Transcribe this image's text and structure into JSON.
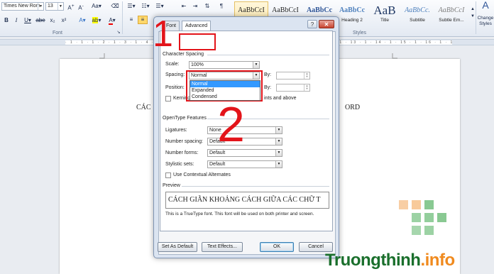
{
  "ribbon": {
    "font_name": "Times New Rom",
    "font_size": "13",
    "font_group_label": "Font",
    "styles_group_label": "Styles",
    "change_styles": "Change Styles",
    "styles": [
      {
        "sample": "AaBbCcI",
        "name": "",
        "active": true
      },
      {
        "sample": "AaBbCcI",
        "name": ""
      },
      {
        "sample": "AaBbCc",
        "name": ""
      },
      {
        "sample": "AaBbCc",
        "name": "Heading 2"
      },
      {
        "sample": "AaB",
        "name": "Title"
      },
      {
        "sample": "AaBbCc.",
        "name": "Subtitle"
      },
      {
        "sample": "AaBbCcI",
        "name": "Subtle Em..."
      }
    ]
  },
  "document": {
    "text_left": "CÁC",
    "text_right": "ORD"
  },
  "dialog": {
    "tabs": [
      "Font",
      "Advanced"
    ],
    "section_character_spacing": "Character Spacing",
    "scale_label": "Scale:",
    "scale_value": "100%",
    "spacing_label": "Spacing:",
    "spacing_value": "Normal",
    "by_label_1": "By:",
    "position_label": "Position:",
    "by_label_2": "By:",
    "kerning_label": "Kerning",
    "kerning_suffix": "ints and above",
    "spacing_options": [
      "Normal",
      "Expanded",
      "Condensed"
    ],
    "section_opentype": "OpenType Features",
    "ligatures_label": "Ligatures:",
    "ligatures_value": "None",
    "number_spacing_label": "Number spacing:",
    "number_spacing_value": "Default",
    "number_forms_label": "Number forms:",
    "number_forms_value": "Default",
    "stylistic_sets_label": "Stylistic sets:",
    "stylistic_sets_value": "Default",
    "contextual_label": "Use Contextual Alternates",
    "section_preview": "Preview",
    "preview_text": "CÁCH GIÃN KHOẢNG CÁCH GIỮA CÁC CHỮ T",
    "preview_note": "This is a TrueType font. This font will be used on both printer and screen.",
    "btn_set_default": "Set As Default",
    "btn_text_effects": "Text Effects...",
    "btn_ok": "OK",
    "btn_cancel": "Cancel"
  },
  "annotations": {
    "num1": "1",
    "num2": "2",
    "color": "#e3141a"
  },
  "watermark": {
    "brand": "Truongthinh",
    "suffix": ".info"
  }
}
